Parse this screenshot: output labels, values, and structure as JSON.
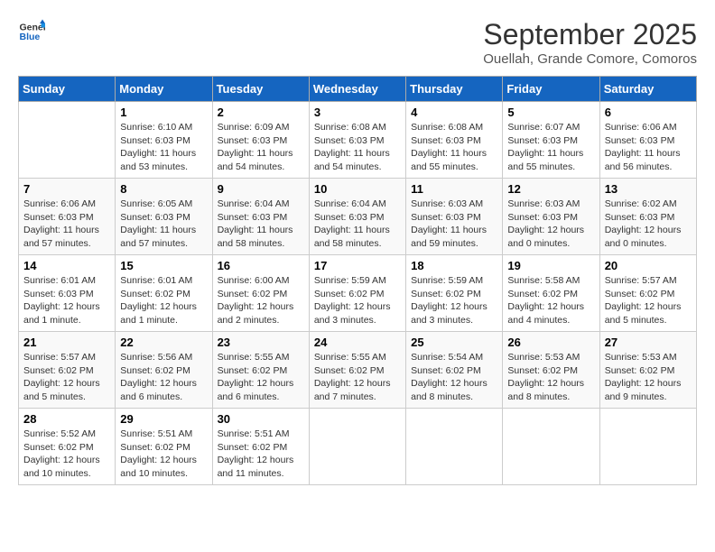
{
  "logo": {
    "line1": "General",
    "line2": "Blue"
  },
  "title": "September 2025",
  "subtitle": "Ouellah, Grande Comore, Comoros",
  "days_header": [
    "Sunday",
    "Monday",
    "Tuesday",
    "Wednesday",
    "Thursday",
    "Friday",
    "Saturday"
  ],
  "weeks": [
    [
      {
        "num": "",
        "sunrise": "",
        "sunset": "",
        "daylight": ""
      },
      {
        "num": "1",
        "sunrise": "Sunrise: 6:10 AM",
        "sunset": "Sunset: 6:03 PM",
        "daylight": "Daylight: 11 hours and 53 minutes."
      },
      {
        "num": "2",
        "sunrise": "Sunrise: 6:09 AM",
        "sunset": "Sunset: 6:03 PM",
        "daylight": "Daylight: 11 hours and 54 minutes."
      },
      {
        "num": "3",
        "sunrise": "Sunrise: 6:08 AM",
        "sunset": "Sunset: 6:03 PM",
        "daylight": "Daylight: 11 hours and 54 minutes."
      },
      {
        "num": "4",
        "sunrise": "Sunrise: 6:08 AM",
        "sunset": "Sunset: 6:03 PM",
        "daylight": "Daylight: 11 hours and 55 minutes."
      },
      {
        "num": "5",
        "sunrise": "Sunrise: 6:07 AM",
        "sunset": "Sunset: 6:03 PM",
        "daylight": "Daylight: 11 hours and 55 minutes."
      },
      {
        "num": "6",
        "sunrise": "Sunrise: 6:06 AM",
        "sunset": "Sunset: 6:03 PM",
        "daylight": "Daylight: 11 hours and 56 minutes."
      }
    ],
    [
      {
        "num": "7",
        "sunrise": "Sunrise: 6:06 AM",
        "sunset": "Sunset: 6:03 PM",
        "daylight": "Daylight: 11 hours and 57 minutes."
      },
      {
        "num": "8",
        "sunrise": "Sunrise: 6:05 AM",
        "sunset": "Sunset: 6:03 PM",
        "daylight": "Daylight: 11 hours and 57 minutes."
      },
      {
        "num": "9",
        "sunrise": "Sunrise: 6:04 AM",
        "sunset": "Sunset: 6:03 PM",
        "daylight": "Daylight: 11 hours and 58 minutes."
      },
      {
        "num": "10",
        "sunrise": "Sunrise: 6:04 AM",
        "sunset": "Sunset: 6:03 PM",
        "daylight": "Daylight: 11 hours and 58 minutes."
      },
      {
        "num": "11",
        "sunrise": "Sunrise: 6:03 AM",
        "sunset": "Sunset: 6:03 PM",
        "daylight": "Daylight: 11 hours and 59 minutes."
      },
      {
        "num": "12",
        "sunrise": "Sunrise: 6:03 AM",
        "sunset": "Sunset: 6:03 PM",
        "daylight": "Daylight: 12 hours and 0 minutes."
      },
      {
        "num": "13",
        "sunrise": "Sunrise: 6:02 AM",
        "sunset": "Sunset: 6:03 PM",
        "daylight": "Daylight: 12 hours and 0 minutes."
      }
    ],
    [
      {
        "num": "14",
        "sunrise": "Sunrise: 6:01 AM",
        "sunset": "Sunset: 6:03 PM",
        "daylight": "Daylight: 12 hours and 1 minute."
      },
      {
        "num": "15",
        "sunrise": "Sunrise: 6:01 AM",
        "sunset": "Sunset: 6:02 PM",
        "daylight": "Daylight: 12 hours and 1 minute."
      },
      {
        "num": "16",
        "sunrise": "Sunrise: 6:00 AM",
        "sunset": "Sunset: 6:02 PM",
        "daylight": "Daylight: 12 hours and 2 minutes."
      },
      {
        "num": "17",
        "sunrise": "Sunrise: 5:59 AM",
        "sunset": "Sunset: 6:02 PM",
        "daylight": "Daylight: 12 hours and 3 minutes."
      },
      {
        "num": "18",
        "sunrise": "Sunrise: 5:59 AM",
        "sunset": "Sunset: 6:02 PM",
        "daylight": "Daylight: 12 hours and 3 minutes."
      },
      {
        "num": "19",
        "sunrise": "Sunrise: 5:58 AM",
        "sunset": "Sunset: 6:02 PM",
        "daylight": "Daylight: 12 hours and 4 minutes."
      },
      {
        "num": "20",
        "sunrise": "Sunrise: 5:57 AM",
        "sunset": "Sunset: 6:02 PM",
        "daylight": "Daylight: 12 hours and 5 minutes."
      }
    ],
    [
      {
        "num": "21",
        "sunrise": "Sunrise: 5:57 AM",
        "sunset": "Sunset: 6:02 PM",
        "daylight": "Daylight: 12 hours and 5 minutes."
      },
      {
        "num": "22",
        "sunrise": "Sunrise: 5:56 AM",
        "sunset": "Sunset: 6:02 PM",
        "daylight": "Daylight: 12 hours and 6 minutes."
      },
      {
        "num": "23",
        "sunrise": "Sunrise: 5:55 AM",
        "sunset": "Sunset: 6:02 PM",
        "daylight": "Daylight: 12 hours and 6 minutes."
      },
      {
        "num": "24",
        "sunrise": "Sunrise: 5:55 AM",
        "sunset": "Sunset: 6:02 PM",
        "daylight": "Daylight: 12 hours and 7 minutes."
      },
      {
        "num": "25",
        "sunrise": "Sunrise: 5:54 AM",
        "sunset": "Sunset: 6:02 PM",
        "daylight": "Daylight: 12 hours and 8 minutes."
      },
      {
        "num": "26",
        "sunrise": "Sunrise: 5:53 AM",
        "sunset": "Sunset: 6:02 PM",
        "daylight": "Daylight: 12 hours and 8 minutes."
      },
      {
        "num": "27",
        "sunrise": "Sunrise: 5:53 AM",
        "sunset": "Sunset: 6:02 PM",
        "daylight": "Daylight: 12 hours and 9 minutes."
      }
    ],
    [
      {
        "num": "28",
        "sunrise": "Sunrise: 5:52 AM",
        "sunset": "Sunset: 6:02 PM",
        "daylight": "Daylight: 12 hours and 10 minutes."
      },
      {
        "num": "29",
        "sunrise": "Sunrise: 5:51 AM",
        "sunset": "Sunset: 6:02 PM",
        "daylight": "Daylight: 12 hours and 10 minutes."
      },
      {
        "num": "30",
        "sunrise": "Sunrise: 5:51 AM",
        "sunset": "Sunset: 6:02 PM",
        "daylight": "Daylight: 12 hours and 11 minutes."
      },
      {
        "num": "",
        "sunrise": "",
        "sunset": "",
        "daylight": ""
      },
      {
        "num": "",
        "sunrise": "",
        "sunset": "",
        "daylight": ""
      },
      {
        "num": "",
        "sunrise": "",
        "sunset": "",
        "daylight": ""
      },
      {
        "num": "",
        "sunrise": "",
        "sunset": "",
        "daylight": ""
      }
    ]
  ]
}
